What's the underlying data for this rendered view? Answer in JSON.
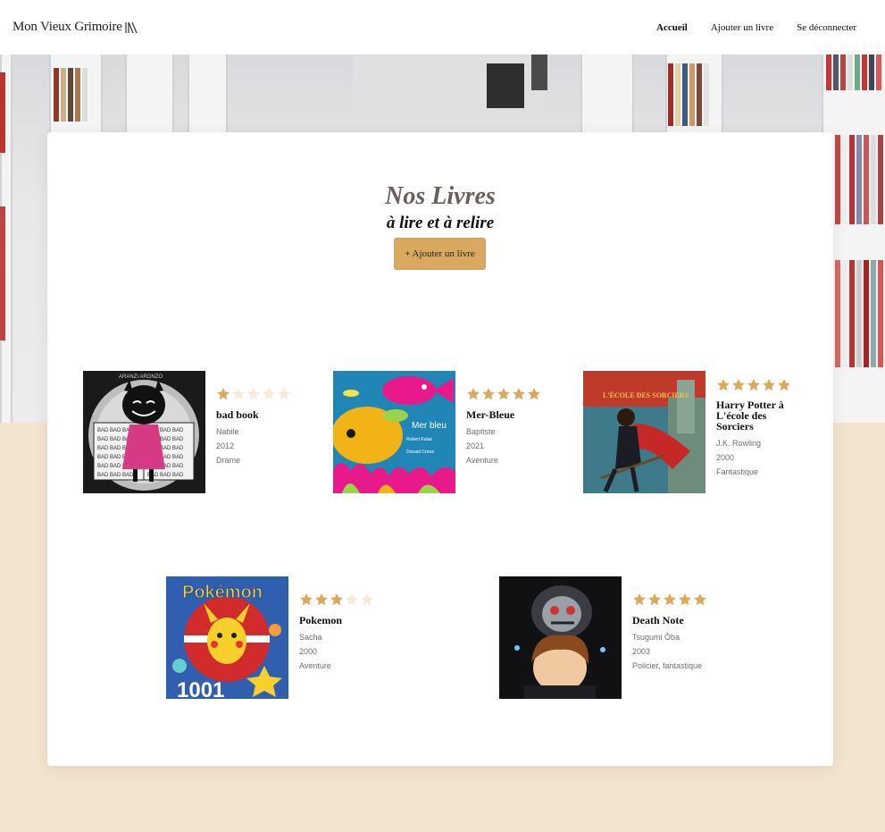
{
  "header": {
    "logo_text": "Mon Vieux Grimoire",
    "nav": [
      {
        "label": "Accueil"
      },
      {
        "label": "Ajouter un livre"
      },
      {
        "label": "Se déconnecter"
      }
    ]
  },
  "main": {
    "title": "Nos Livres",
    "subtitle": "à lire et à relire",
    "add_button": "+ Ajouter un livre"
  },
  "books": [
    {
      "title": "bad book",
      "author": "Nabile",
      "year": "2012",
      "genre": "Drame",
      "rating": 1
    },
    {
      "title": "Mer-Bleue",
      "author": "Baptiste",
      "year": "2021",
      "genre": "Aventure",
      "rating": 5
    },
    {
      "title": "Harry Potter à L'école des Sorciers",
      "author": "J.K. Rowling",
      "year": "2000",
      "genre": "Fantastique",
      "rating": 5
    },
    {
      "title": "Pokemon",
      "author": "Sacha",
      "year": "2000",
      "genre": "Aventure",
      "rating": 3
    },
    {
      "title": "Death Note",
      "author": "Tsugumi Ōba",
      "year": "2003",
      "genre": "Policier, fantastique",
      "rating": 5
    }
  ],
  "colors": {
    "accent": "#d8a95e",
    "star_empty": "#f6ebd9",
    "page_background": "#f3e4cf"
  }
}
